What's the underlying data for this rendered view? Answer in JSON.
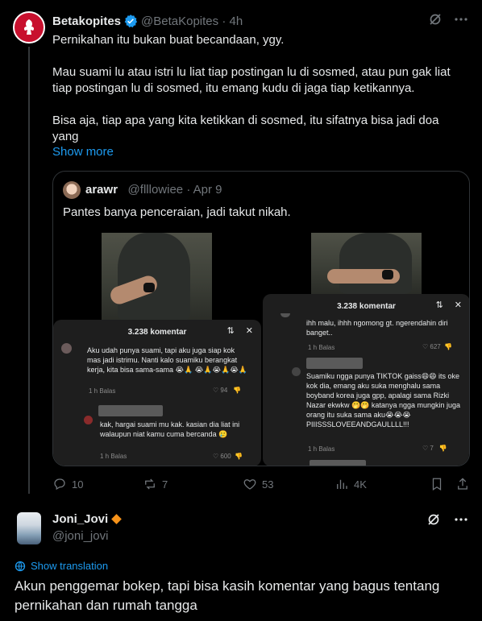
{
  "tweet": {
    "name": "Betakopites",
    "handle": "@BetaKopites",
    "time": "4h",
    "paragraphs": [
      "Pernikahan itu bukan buat becandaan, ygy.",
      "Mau suami lu atau istri lu liat tiap postingan lu di sosmed, atau pun gak liat tiap postingan lu di sosmed, itu emang kudu di jaga tiap ketikannya.",
      "Bisa aja, tiap apa yang kita ketikkan di sosmed, itu sifatnya bisa jadi doa yang"
    ],
    "show_more": "Show more",
    "brand_color": "#c8102e"
  },
  "quote": {
    "name": "arawr",
    "handle": "@flllowiee",
    "date": "Apr 9",
    "text": "Pantes banya penceraian, jadi takut nikah.",
    "left_panel": {
      "header": "3.238 komentar",
      "comment1": "Aku udah punya suami, tapi aku juga siap kok mas jadi istrimu. Nanti kalo suamiku berangkat kerja, kita bisa sama-sama 😭🙏 😭🙏😭🙏😭🙏",
      "comment1_meta": "1 h     Balas",
      "comment1_likes": "94",
      "comment2": "kak, hargai suami mu kak. kasian dia liat ini walaupun niat kamu cuma bercanda 🥲",
      "comment2_meta": "1 h     Balas",
      "comment2_likes": "600"
    },
    "right_panel": {
      "header": "3.238 komentar",
      "comment1": "ihh malu, ihhh ngomong gt. ngerendahin diri banget..",
      "comment1_meta": "1 h     Balas",
      "comment1_likes": "627",
      "comment2": "Suamiku ngga punya TIKTOK gaiss😄😄 its oke kok dia, emang aku suka menghalu sama boyband korea juga gpp, apalagi sama Rizki Nazar ekwkw 🤭🤭 katanya ngga mungkin juga orang itu suka sama aku😭😭😭 PIIISSSLOVEEANDGAULLLL!!!",
      "comment2_meta": "1 h     Balas",
      "comment2_likes": "7"
    }
  },
  "actions": {
    "replies": "10",
    "retweets": "7",
    "likes": "53",
    "views": "4K"
  },
  "reply": {
    "name": "Joni_Jovi",
    "handle": "@joni_jovi",
    "show_translation": "Show translation",
    "text": "Akun penggemar bokep, tapi bisa kasih komentar yang bagus tentang pernikahan dan rumah tangga",
    "badge_color": "#f7931a"
  }
}
